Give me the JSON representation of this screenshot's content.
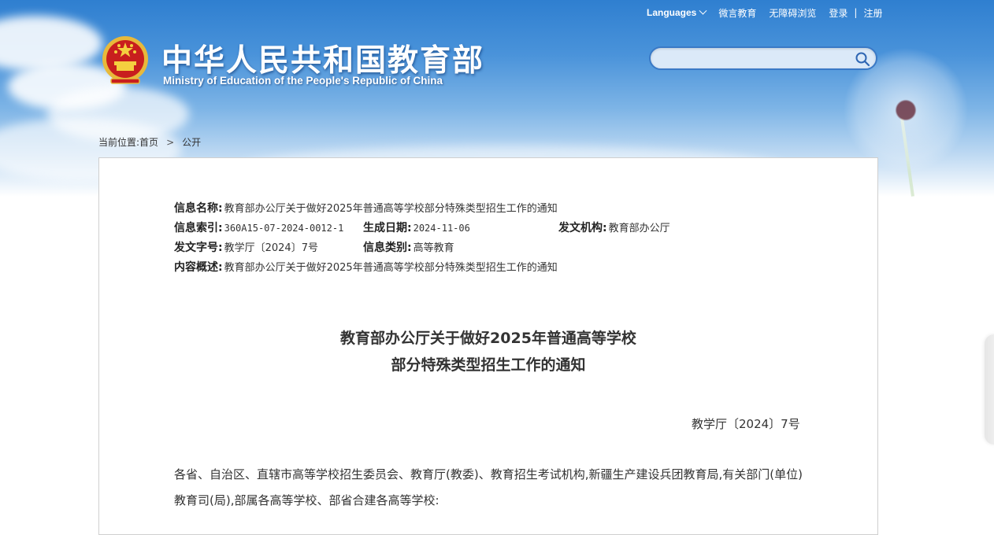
{
  "header": {
    "title_cn": "中华人民共和国教育部",
    "title_en": "Ministry of Education of the People's Republic of China",
    "emblem_icon": "national-emblem-icon"
  },
  "topnav": {
    "languages": "Languages",
    "weiyan": "微言教育",
    "accessibility": "无障碍浏览",
    "login": "登录",
    "separator": "|",
    "register": "注册"
  },
  "search": {
    "placeholder": "",
    "icon": "search-icon"
  },
  "breadcrumb": {
    "prefix": "当前位置:",
    "home": "首页",
    "separator": ">",
    "current": "公开"
  },
  "meta": {
    "name_label": "信息名称:",
    "name_value": "教育部办公厅关于做好2025年普通高等学校部分特殊类型招生工作的通知",
    "index_label": "信息索引:",
    "index_value": "360A15-07-2024-0012-1",
    "date_label": "生成日期:",
    "date_value": "2024-11-06",
    "org_label": "发文机构:",
    "org_value": "教育部办公厅",
    "docno_label": "发文字号:",
    "docno_value": "教学厅〔2024〕7号",
    "category_label": "信息类别:",
    "category_value": "高等教育",
    "summary_label": "内容概述:",
    "summary_value": "教育部办公厅关于做好2025年普通高等学校部分特殊类型招生工作的通知"
  },
  "document": {
    "title_line1": "教育部办公厅关于做好2025年普通高等学校",
    "title_line2": "部分特殊类型招生工作的通知",
    "number": "教学厅〔2024〕7号",
    "body": "各省、自治区、直辖市高等学校招生委员会、教育厅(教委)、教育招生考试机构,新疆生产建设兵团教育局,有关部门(单位)教育司(局),部属各高等学校、部省合建各高等学校:"
  },
  "colors": {
    "sky_top": "#2f7fd0",
    "search_border": "#3a79c6",
    "text": "#333333"
  }
}
